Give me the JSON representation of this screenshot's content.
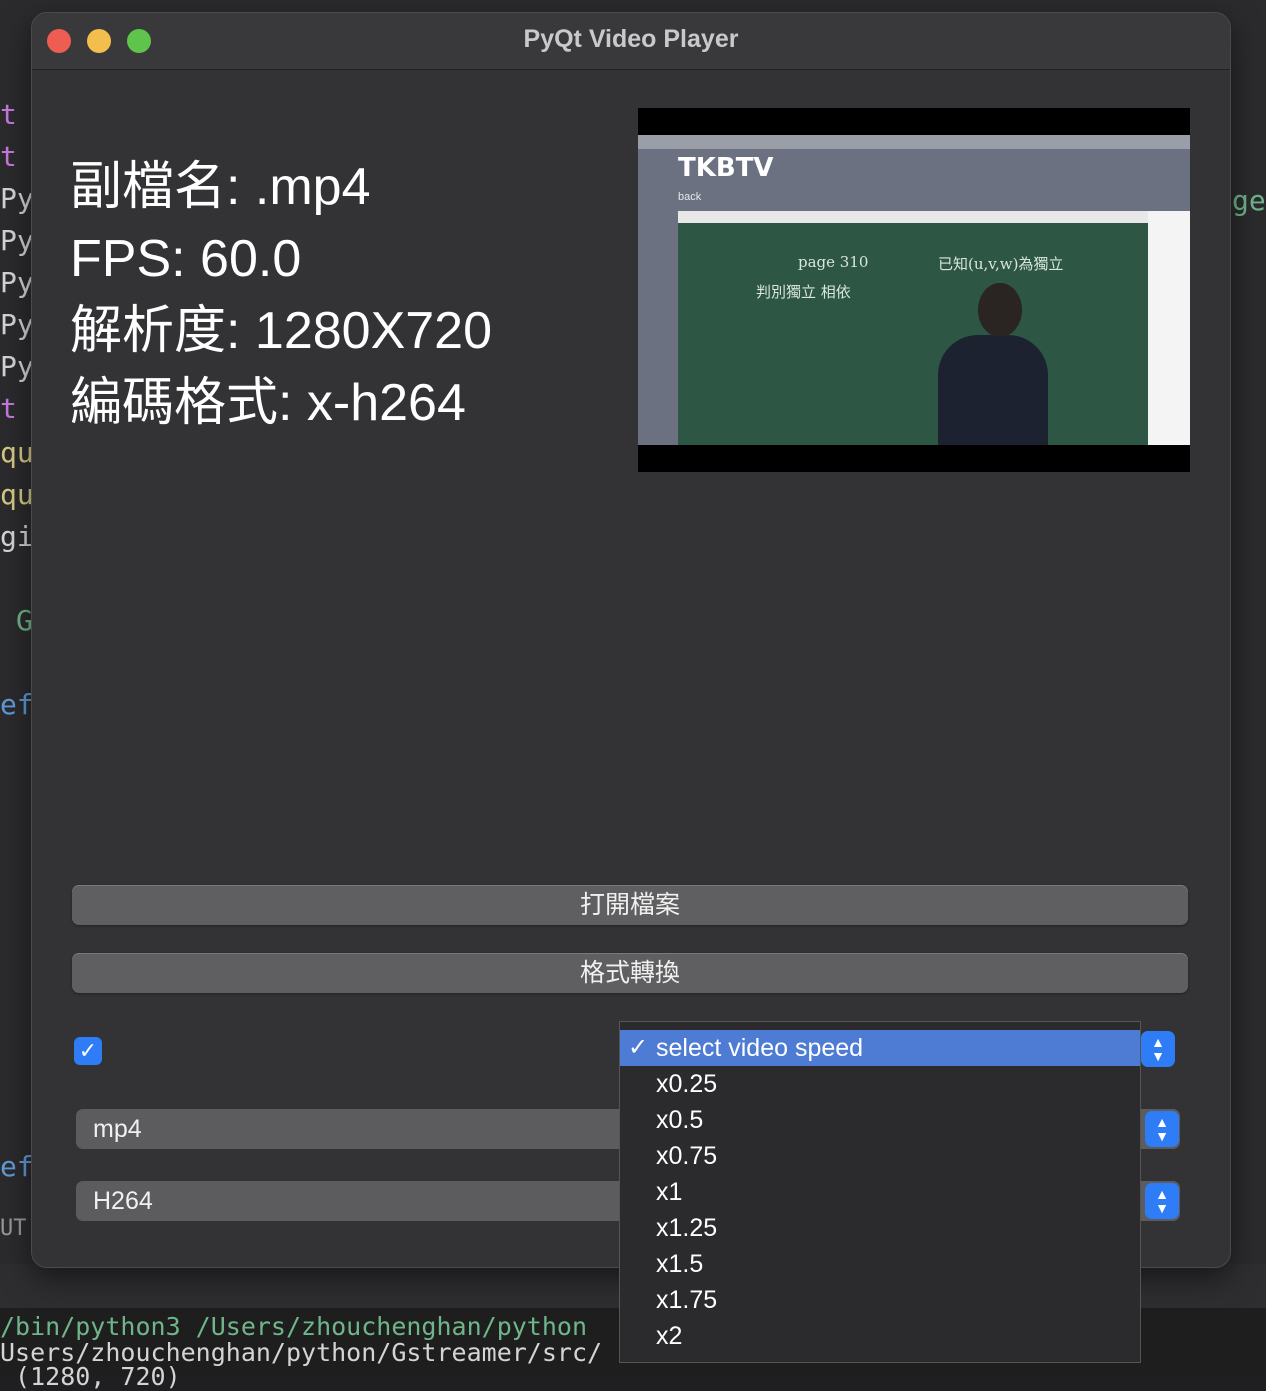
{
  "background_editor": {
    "gutter": [
      "t",
      "t",
      "Py",
      "Py",
      "Py",
      "Py",
      "Py",
      "t",
      "qu",
      "qu",
      "gi",
      "G",
      "ef",
      "ef",
      "UT"
    ],
    "right_fragment": "ge",
    "terminal": [
      "/bin/python3 /Users/zhouchenghan/python",
      "Users/zhouchenghan/python/Gstreamer/src/",
      " (1280, 720)"
    ]
  },
  "window": {
    "title": "PyQt Video Player"
  },
  "info": {
    "extension": "副檔名: .mp4",
    "fps": "FPS: 60.0",
    "resolution": "解析度: 1280X720",
    "codec": "編碼格式: x-h264"
  },
  "video_preview": {
    "logo": "TKBTV",
    "back": "back",
    "chalk_1": "page 310",
    "chalk_2": "判別獨立 相依",
    "chalk_3": "已知(u,v,w)為獨立"
  },
  "buttons": {
    "open_file": "打開檔案",
    "convert_format": "格式轉換"
  },
  "checkbox": {
    "checked": true
  },
  "combos": {
    "format": "mp4",
    "codec": "H264"
  },
  "speed_menu": {
    "selected": "select video speed",
    "options": [
      "x0.25",
      "x0.5",
      "x0.75",
      "x1",
      "x1.25",
      "x1.5",
      "x1.75",
      "x2"
    ]
  },
  "colors": {
    "accent": "#2e7df6",
    "selection": "#4e7bd3"
  }
}
